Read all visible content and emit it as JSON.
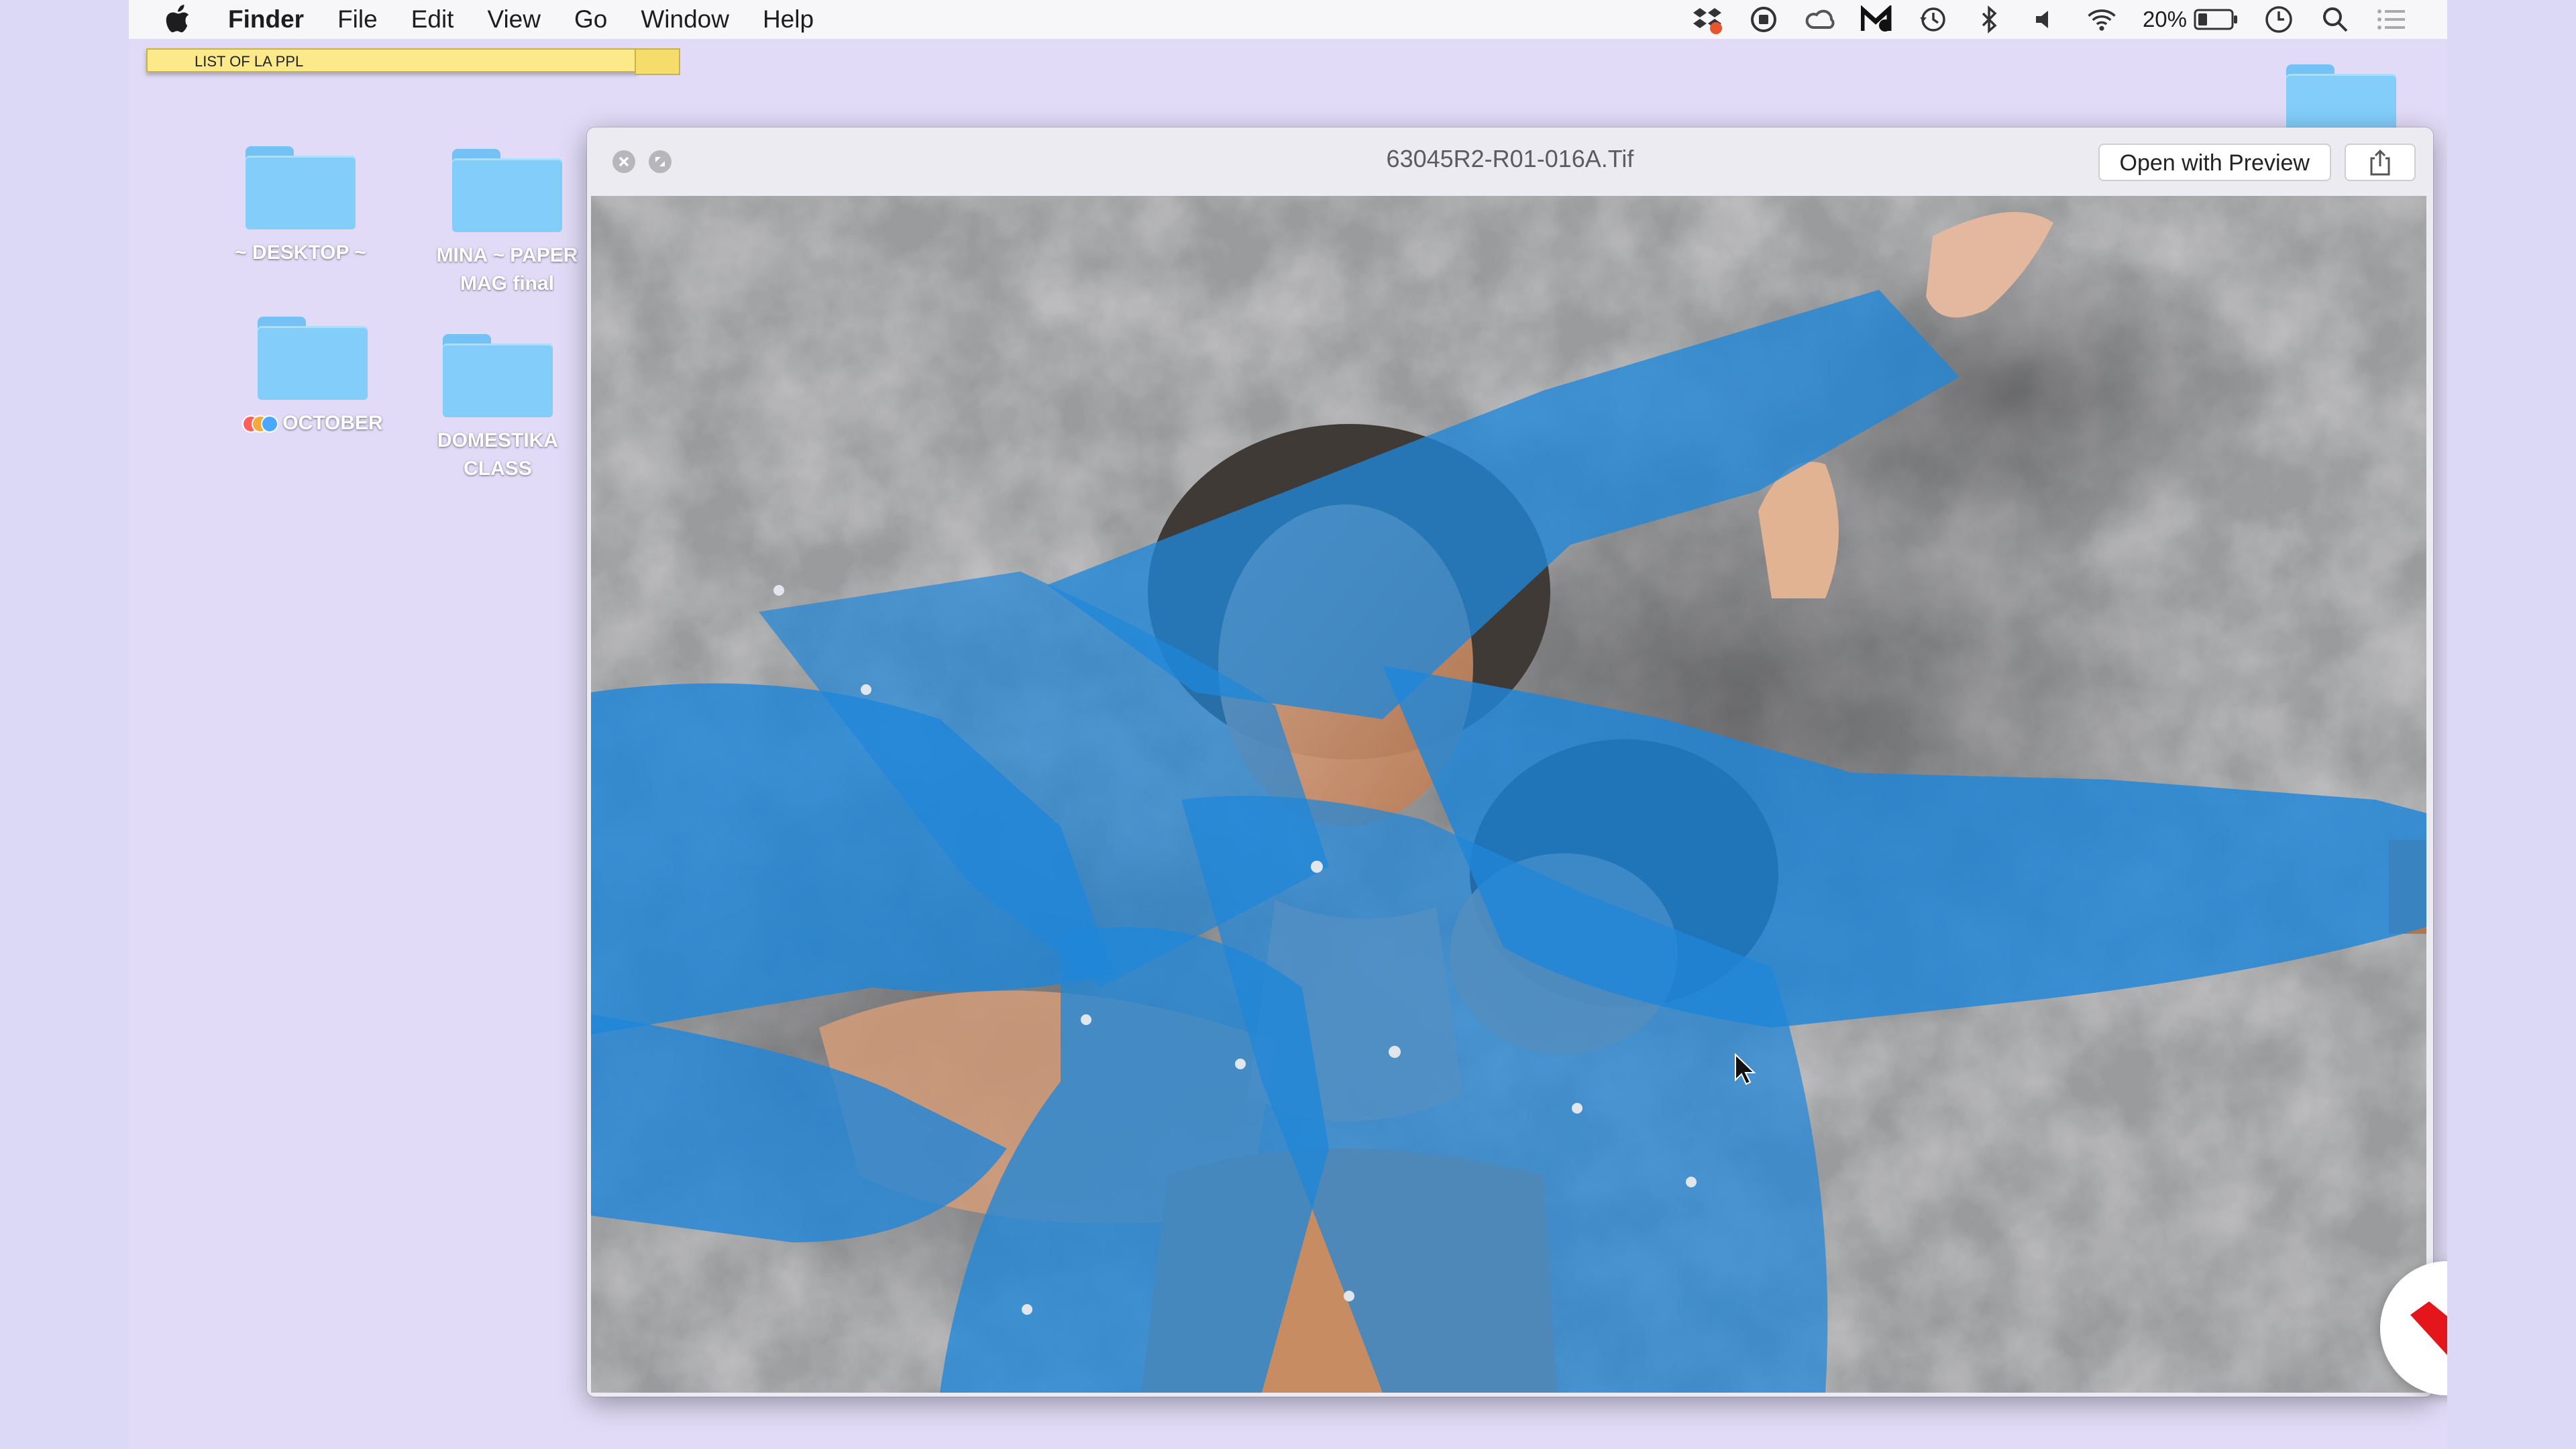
{
  "menubar": {
    "app_name": "Finder",
    "items": [
      "File",
      "Edit",
      "View",
      "Go",
      "Window",
      "Help"
    ],
    "battery_percent": "20%"
  },
  "sticky_note": {
    "text": "LIST OF LA PPL"
  },
  "desktop": {
    "folders": [
      {
        "label": "~ DESKTOP ~"
      },
      {
        "label_line1": "MINA ~  PAPER",
        "label_line2": "MAG final"
      },
      {
        "label": "OCTOBER",
        "tags": [
          "#ff5e5e",
          "#f6a93b",
          "#4aa8ff"
        ]
      },
      {
        "label_line1": "DOMESTIKA",
        "label_line2": "CLASS"
      }
    ]
  },
  "quicklook": {
    "title": "63045R2-R01-016A.Tif",
    "open_button_label": "Open with Preview"
  },
  "colors": {
    "desktop_bg": "#e1dbf7",
    "folder_blue": "#82cdfa",
    "jacket_blue": "#1f86d9",
    "badge_red": "#e4161b"
  }
}
